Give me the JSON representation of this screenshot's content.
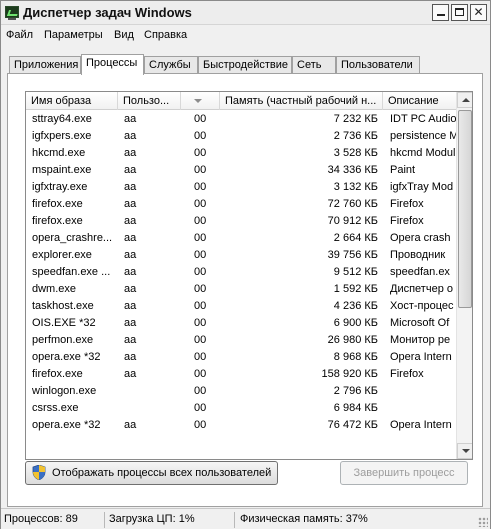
{
  "window": {
    "title": "Диспетчер задач Windows"
  },
  "menu": [
    "Файл",
    "Параметры",
    "Вид",
    "Справка"
  ],
  "tabs": [
    "Приложения",
    "Процессы",
    "Службы",
    "Быстродействие",
    "Сеть",
    "Пользователи"
  ],
  "active_tab": "Процессы",
  "columns": [
    "Имя образа",
    "Пользо...",
    "",
    "Память (частный рабочий н...",
    "Описание"
  ],
  "processes": [
    {
      "name": "sttray64.exe",
      "user": "aa",
      "cpu": "00",
      "mem": "7 232 КБ",
      "desc": "IDT PC Audio"
    },
    {
      "name": "igfxpers.exe",
      "user": "aa",
      "cpu": "00",
      "mem": "2 736 КБ",
      "desc": "persistence M"
    },
    {
      "name": "hkcmd.exe",
      "user": "aa",
      "cpu": "00",
      "mem": "3 528 КБ",
      "desc": "hkcmd Modul"
    },
    {
      "name": "mspaint.exe",
      "user": "aa",
      "cpu": "00",
      "mem": "34 336 КБ",
      "desc": "Paint"
    },
    {
      "name": "igfxtray.exe",
      "user": "aa",
      "cpu": "00",
      "mem": "3 132 КБ",
      "desc": "igfxTray Mod"
    },
    {
      "name": "firefox.exe",
      "user": "aa",
      "cpu": "00",
      "mem": "72 760 КБ",
      "desc": "Firefox"
    },
    {
      "name": "firefox.exe",
      "user": "aa",
      "cpu": "00",
      "mem": "70 912 КБ",
      "desc": "Firefox"
    },
    {
      "name": "opera_crashre...",
      "user": "aa",
      "cpu": "00",
      "mem": "2 664 КБ",
      "desc": "Opera crash"
    },
    {
      "name": "explorer.exe",
      "user": "aa",
      "cpu": "00",
      "mem": "39 756 КБ",
      "desc": "Проводник"
    },
    {
      "name": "speedfan.exe ...",
      "user": "aa",
      "cpu": "00",
      "mem": "9 512 КБ",
      "desc": "speedfan.ex"
    },
    {
      "name": "dwm.exe",
      "user": "aa",
      "cpu": "00",
      "mem": "1 592 КБ",
      "desc": "Диспетчер о"
    },
    {
      "name": "taskhost.exe",
      "user": "aa",
      "cpu": "00",
      "mem": "4 236 КБ",
      "desc": "Хост-процес"
    },
    {
      "name": "OIS.EXE *32",
      "user": "aa",
      "cpu": "00",
      "mem": "6 900 КБ",
      "desc": "Microsoft Of"
    },
    {
      "name": "perfmon.exe",
      "user": "aa",
      "cpu": "00",
      "mem": "26 980 КБ",
      "desc": "Монитор ре"
    },
    {
      "name": "opera.exe *32",
      "user": "aa",
      "cpu": "00",
      "mem": "8 968 КБ",
      "desc": "Opera Intern"
    },
    {
      "name": "firefox.exe",
      "user": "aa",
      "cpu": "00",
      "mem": "158 920 КБ",
      "desc": "Firefox"
    },
    {
      "name": "winlogon.exe",
      "user": "",
      "cpu": "00",
      "mem": "2 796 КБ",
      "desc": ""
    },
    {
      "name": "csrss.exe",
      "user": "",
      "cpu": "00",
      "mem": "6 984 КБ",
      "desc": ""
    },
    {
      "name": "opera.exe *32",
      "user": "aa",
      "cpu": "00",
      "mem": "76 472 КБ",
      "desc": "Opera Intern"
    }
  ],
  "buttons": {
    "show_all": "Отображать процессы всех пользователей",
    "end_process": "Завершить процесс"
  },
  "status": {
    "processes": "Процессов: 89",
    "cpu": "Загрузка ЦП: 1%",
    "memory": "Физическая память: 37%"
  }
}
